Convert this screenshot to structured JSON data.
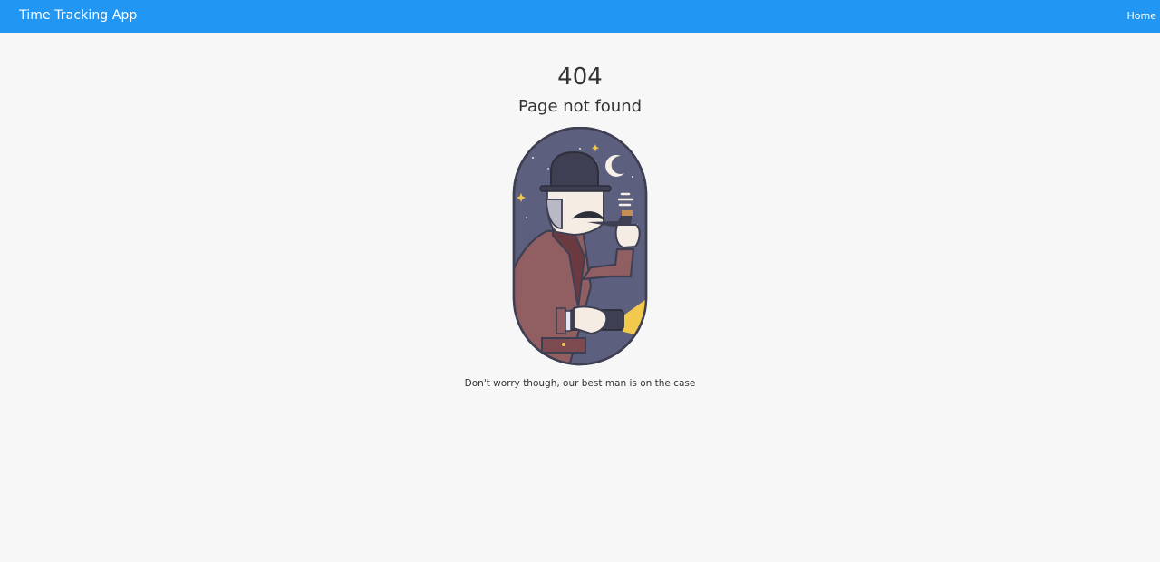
{
  "navbar": {
    "brand": "Time Tracking App",
    "links": [
      {
        "label": "Home"
      }
    ],
    "color": "#2196f3"
  },
  "error": {
    "code": "404",
    "title": "Page not found",
    "message": "Don't worry though, our best man is on the case"
  },
  "illustration": {
    "icon": "detective-illustration"
  }
}
